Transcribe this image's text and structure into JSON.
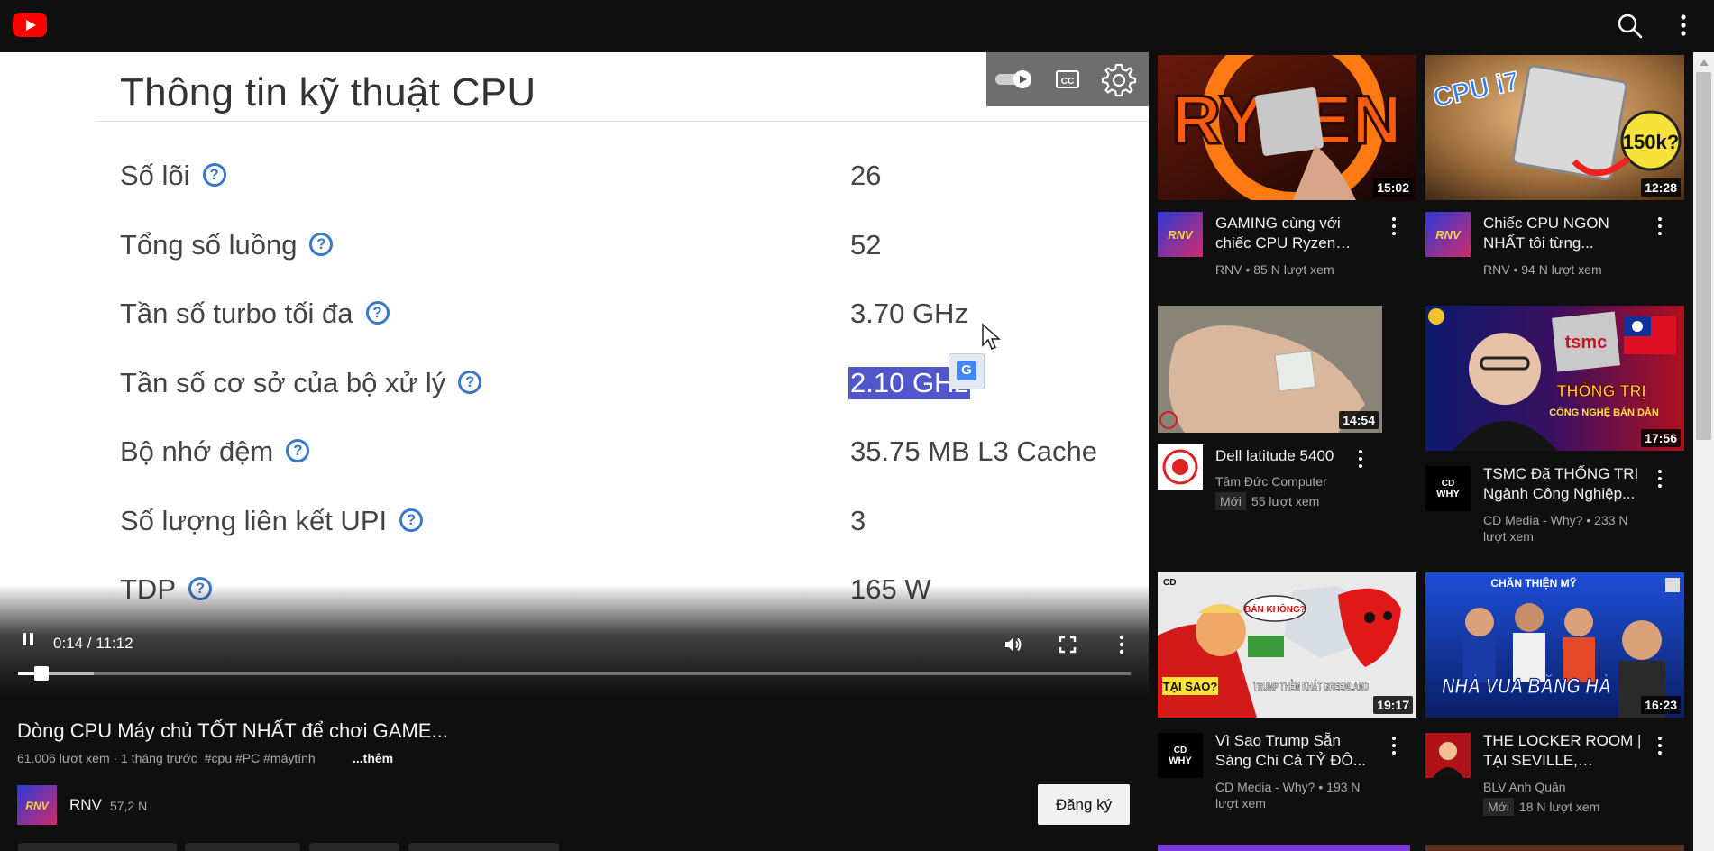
{
  "topbar": {
    "logo_icon": "youtube-logo-icon",
    "search_icon": "search-icon",
    "menu_icon": "more-vertical-icon"
  },
  "player": {
    "spec_title": "Thông tin kỹ thuật CPU",
    "spec_rows": [
      {
        "label": "Số lõi",
        "value": "26"
      },
      {
        "label": "Tổng số luồng",
        "value": "52"
      },
      {
        "label": "Tần số turbo tối đa",
        "value": "3.70 GHz"
      },
      {
        "label": "Tần số cơ sở của bộ xử lý",
        "value": "2.10 GHz"
      },
      {
        "label": "Bộ nhớ đệm",
        "value": "35.75 MB L3 Cache"
      },
      {
        "label": "Số lượng liên kết UPI",
        "value": "3"
      },
      {
        "label": "TDP",
        "value": "165 W"
      }
    ],
    "help_glyph": "?",
    "translate_glyph": "G",
    "time": "0:14 / 11:12",
    "progress_fraction": 0.021,
    "buffer_fraction": 0.068
  },
  "video": {
    "title": "Dòng CPU Máy chủ TỐT NHẤT để chơi GAME...",
    "meta": "61.006 lượt xem · 1 tháng trước",
    "tags": "#cpu #PC #máytính",
    "more": "...thêm",
    "channel_name": "RNV",
    "channel_subs": "57,2 N",
    "subscribe": "Đăng ký",
    "avatar_text": "RNV"
  },
  "recommendations": [
    {
      "title": "GAMING cùng với chiếc CPU Ryzen yếu...",
      "channel": "RNV",
      "views": "85 N lượt xem",
      "duration": "15:02",
      "new": false,
      "avatar_text": "RNV",
      "thumb_text": "RYZEN"
    },
    {
      "title": "Chiếc CPU NGON NHẤT tôi từng...",
      "channel": "RNV",
      "views": "94 N lượt xem",
      "duration": "12:28",
      "new": false,
      "avatar_text": "RNV",
      "thumb_text": "CPU i7",
      "thumb_text2": "150k?"
    },
    {
      "title": "Dell latitude 5400",
      "channel": "Tâm Đức Computer",
      "views": "55 lượt xem",
      "duration": "14:54",
      "new": true,
      "new_label": "Mới",
      "avatar_text": ""
    },
    {
      "title": "TSMC Đã THỐNG TRỊ Ngành Công Nghiệp...",
      "channel": "CD Media - Why?",
      "views": "233 N lượt xem",
      "duration": "17:56",
      "new": false,
      "avatar_text": "WHY",
      "thumb_text": "tsmc",
      "thumb_text2": "THỐNG TRỊ",
      "thumb_text3": "CÔNG NGHỆ BÁN DẪN"
    },
    {
      "title": "Vì Sao Trump Sẵn Sàng Chi Cả TỶ ĐÔ...",
      "channel": "CD Media - Why?",
      "views": "193 N lượt xem",
      "duration": "19:17",
      "new": false,
      "avatar_text": "WHY",
      "thumb_text": "TẠI SAO?",
      "thumb_text2": "TRUMP THÈM KHÁT GREENLAND",
      "thumb_text3": "BÁN KHÔNG?"
    },
    {
      "title": "THE LOCKER ROOM | TẠI SEVILLE, BARÇA...",
      "channel": "BLV Anh Quân",
      "views": "18 N lượt xem",
      "duration": "16:23",
      "new": true,
      "new_label": "Mới",
      "avatar_text": "",
      "thumb_text": "NHÀ VUA BĂNG HÀ",
      "thumb_text2": "CHĂN THIỆN MỸ"
    }
  ]
}
